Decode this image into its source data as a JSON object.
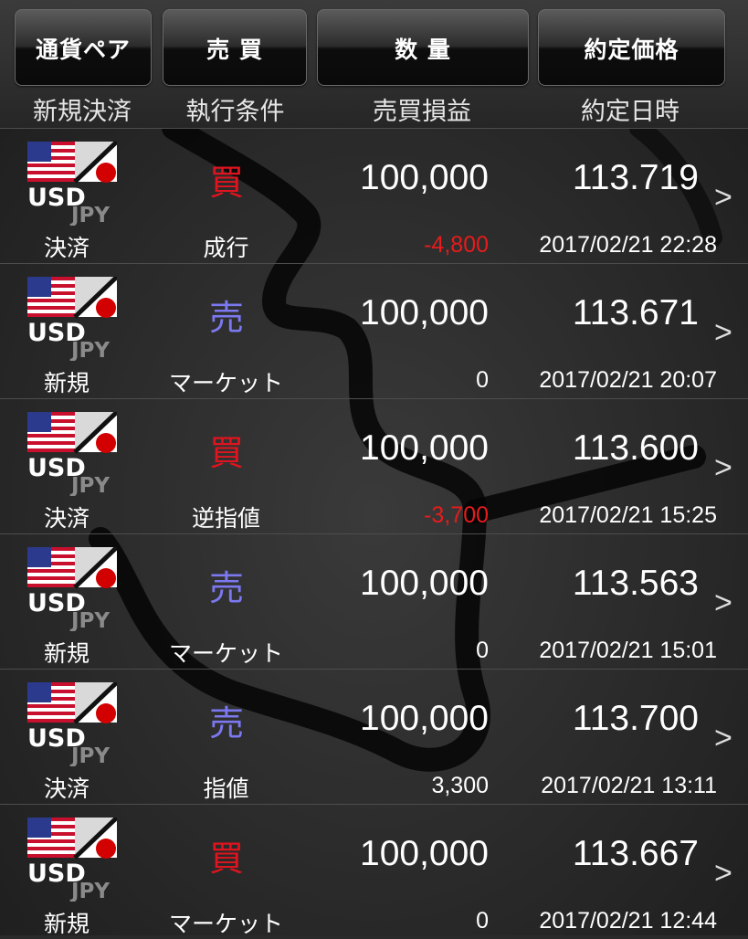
{
  "colors": {
    "buy": "#e0141e",
    "sell": "#7b78f0",
    "loss": "#e81b1b",
    "normal": "#ffffff"
  },
  "header": {
    "buttons": [
      "通貨ペア",
      "売 買",
      "数 量",
      "約定価格"
    ],
    "subheaders": [
      "新規決済",
      "執行条件",
      "売買損益",
      "約定日時"
    ]
  },
  "rows": [
    {
      "pair_base": "USD",
      "pair_quote": "JPY",
      "side": "買",
      "side_kind": "buy",
      "quantity": "100,000",
      "price": "113.719",
      "type": "決済",
      "condition": "成行",
      "pl": "-4,800",
      "pl_kind": "loss",
      "datetime": "2017/02/21 22:28"
    },
    {
      "pair_base": "USD",
      "pair_quote": "JPY",
      "side": "売",
      "side_kind": "sell",
      "quantity": "100,000",
      "price": "113.671",
      "type": "新規",
      "condition": "マーケット",
      "pl": "0",
      "pl_kind": "normal",
      "datetime": "2017/02/21 20:07"
    },
    {
      "pair_base": "USD",
      "pair_quote": "JPY",
      "side": "買",
      "side_kind": "buy",
      "quantity": "100,000",
      "price": "113.600",
      "type": "決済",
      "condition": "逆指値",
      "pl": "-3,700",
      "pl_kind": "loss",
      "datetime": "2017/02/21 15:25"
    },
    {
      "pair_base": "USD",
      "pair_quote": "JPY",
      "side": "売",
      "side_kind": "sell",
      "quantity": "100,000",
      "price": "113.563",
      "type": "新規",
      "condition": "マーケット",
      "pl": "0",
      "pl_kind": "normal",
      "datetime": "2017/02/21 15:01"
    },
    {
      "pair_base": "USD",
      "pair_quote": "JPY",
      "side": "売",
      "side_kind": "sell",
      "quantity": "100,000",
      "price": "113.700",
      "type": "決済",
      "condition": "指値",
      "pl": "3,300",
      "pl_kind": "normal",
      "datetime": "2017/02/21 13:11"
    },
    {
      "pair_base": "USD",
      "pair_quote": "JPY",
      "side": "買",
      "side_kind": "buy",
      "quantity": "100,000",
      "price": "113.667",
      "type": "新規",
      "condition": "マーケット",
      "pl": "0",
      "pl_kind": "normal",
      "datetime": "2017/02/21 12:44"
    }
  ],
  "row_chevron": ">"
}
